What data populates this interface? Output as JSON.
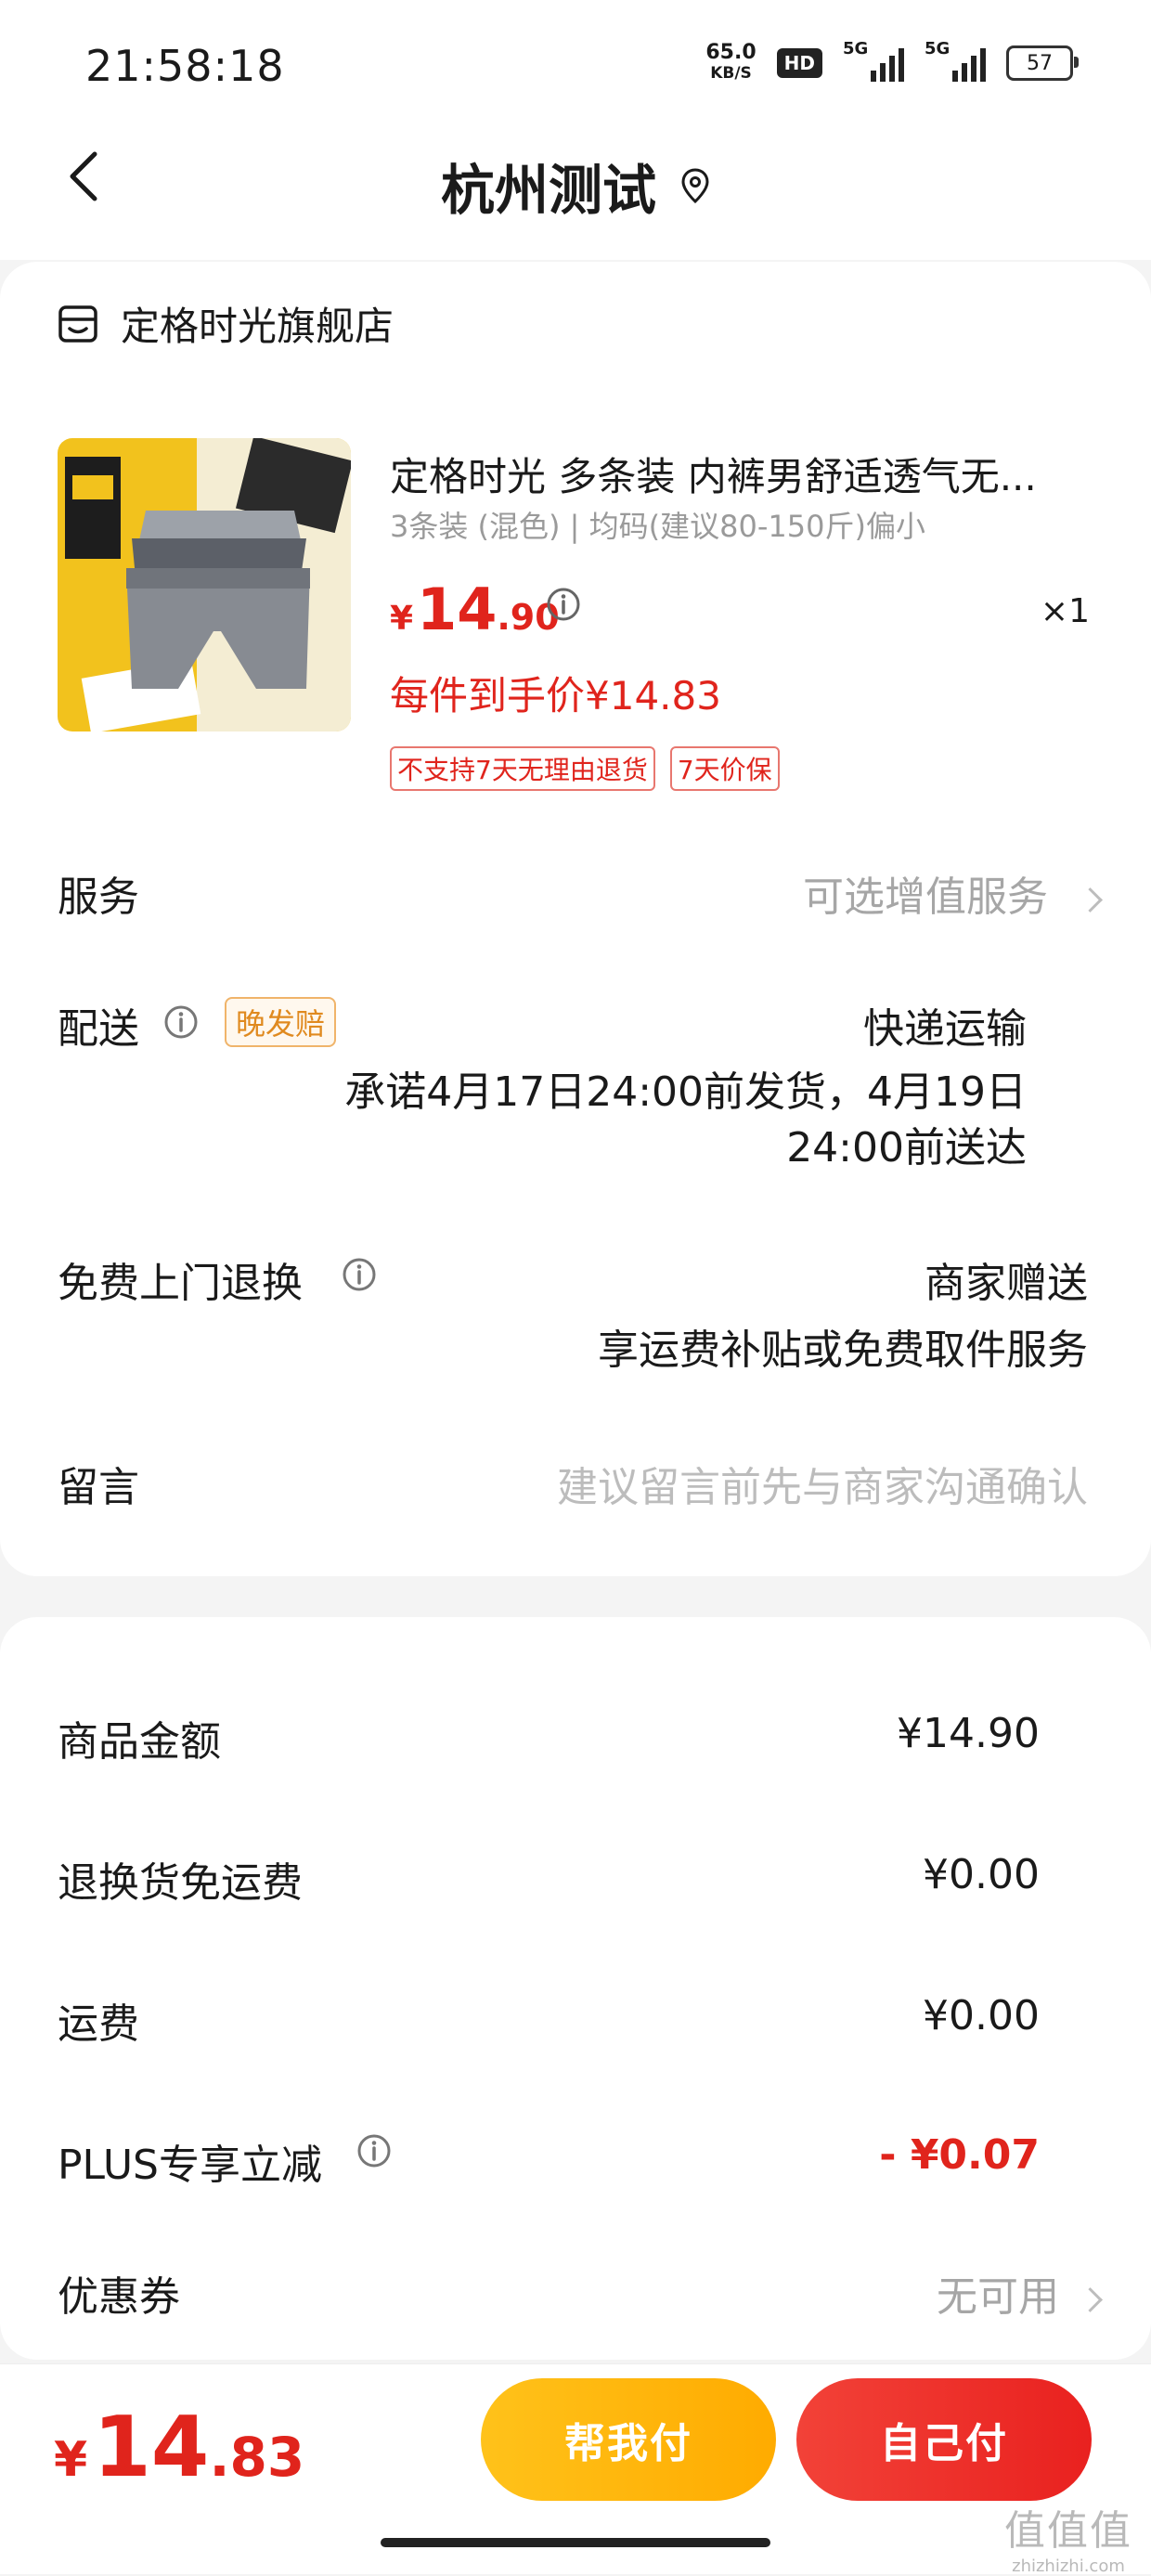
{
  "status_bar": {
    "time": "21:58:18",
    "net_speed": "65.0",
    "net_unit": "KB/S",
    "hd_label": "HD",
    "signal1_label": "5G",
    "signal2_label": "5G",
    "battery": "57"
  },
  "nav": {
    "title": "杭州测试"
  },
  "shop": {
    "name": "定格时光旗舰店"
  },
  "product": {
    "title": "定格时光 多条装 内裤男舒适透气无...",
    "spec": "3条装 (混色) | 均码(建议80-150斤)偏小",
    "price_yen": "¥",
    "price_int": "14",
    "price_dec": ".90",
    "quantity": "×1",
    "net_price": "每件到手价¥14.83",
    "tags": [
      "不支持7天无理由退货",
      "7天价保"
    ]
  },
  "rows": {
    "service_label": "服务",
    "service_value": "可选增值服务",
    "delivery_label": "配送",
    "delivery_badge": "晚发赔",
    "delivery_method": "快递运输",
    "delivery_promise_line1": "承诺4月17日24:00前发货，4月19日",
    "delivery_promise_line2": "24:00前送达",
    "free_return_label": "免费上门退换",
    "free_return_value1": "商家赠送",
    "free_return_value2": "享运费补贴或免费取件服务",
    "message_label": "留言",
    "message_placeholder": "建议留言前先与商家沟通确认"
  },
  "summary": {
    "goods_amount_label": "商品金额",
    "goods_amount_value": "¥14.90",
    "return_free_label": "退换货免运费",
    "return_free_value": "¥0.00",
    "shipping_label": "运费",
    "shipping_value": "¥0.00",
    "plus_label": "PLUS专享立减",
    "plus_value": "- ¥0.07",
    "coupon_label": "优惠券",
    "coupon_value": "无可用"
  },
  "bottom": {
    "total_yen": "¥",
    "total_int": "14",
    "total_dec": ".83",
    "help_pay_label": "帮我付",
    "self_pay_label": "自己付"
  },
  "watermark": {
    "text": "值值值",
    "domain": "zhizhizhi.com"
  },
  "colors": {
    "accent_red": "#e0241c",
    "button_yellow": "#ffb400",
    "button_red": "#ec2a24"
  }
}
